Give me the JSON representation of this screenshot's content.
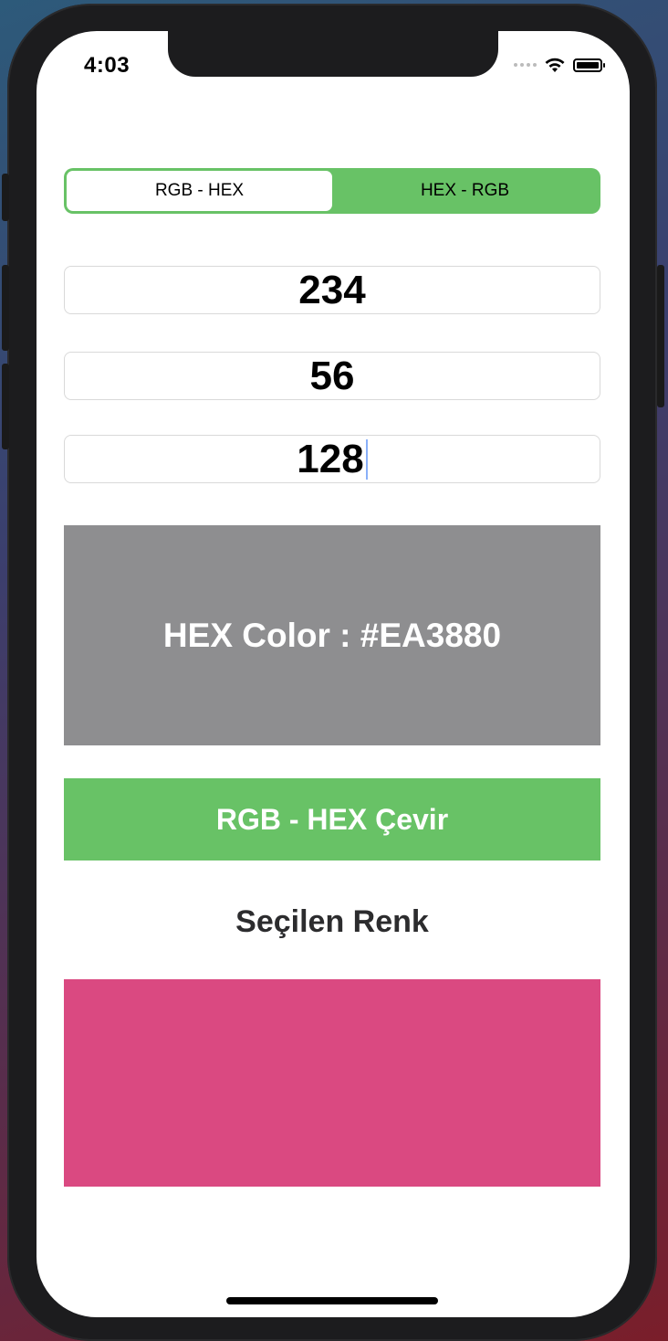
{
  "status_bar": {
    "time": "4:03"
  },
  "segmented_control": {
    "options": [
      "RGB -  HEX",
      "HEX - RGB"
    ],
    "selected_index": 0
  },
  "inputs": {
    "red": "234",
    "green": "56",
    "blue": "128"
  },
  "hex_result": {
    "text": "HEX Color : #EA3880"
  },
  "convert_button": {
    "label": "RGB - HEX Çevir"
  },
  "selected_color": {
    "label": "Seçilen Renk",
    "color": "#DA4981"
  },
  "colors": {
    "accent_green": "#68C266",
    "result_gray": "#8E8E90"
  }
}
